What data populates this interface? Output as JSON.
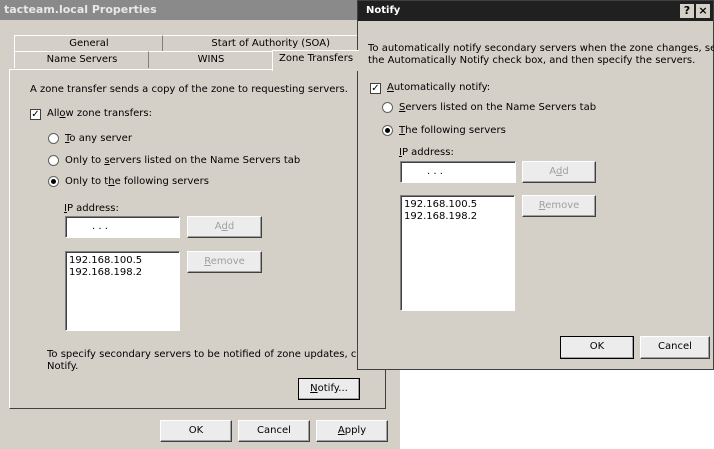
{
  "props": {
    "title": "tacteam.local Properties",
    "tabs_back": [
      "General",
      "Start of Authority (SOA)"
    ],
    "tabs_front": [
      "Name Servers",
      "WINS",
      "Zone Transfers"
    ],
    "intro": "A zone transfer sends a copy of the zone to requesting servers.",
    "allow_prefix": "All",
    "allow_ul": "o",
    "allow_suffix": "w zone transfers:",
    "opt1_ul": "T",
    "opt1_rest": "o any server",
    "opt2_prefix": "Only to ",
    "opt2_ul": "s",
    "opt2_suffix": "ervers listed on the Name Servers tab",
    "opt3_prefix": "Only to t",
    "opt3_ul": "h",
    "opt3_suffix": "e following servers",
    "ip_ul": "I",
    "ip_rest": "P address:",
    "ip_placeholder": ".     .     .",
    "add_prefix": "A",
    "add_ul": "d",
    "add_suffix": "d",
    "remove_ul": "R",
    "remove_rest": "emove",
    "servers": [
      "192.168.100.5",
      "192.168.198.2"
    ],
    "notify_note_1": "To specify secondary servers to be notified of zone updates, click",
    "notify_note_2": "Notify.",
    "notify_ul": "N",
    "notify_rest": "otify...",
    "ok": "OK",
    "cancel": "Cancel",
    "apply_ul": "A",
    "apply_rest": "pply"
  },
  "notify": {
    "title": "Notify",
    "help": "?",
    "close": "×",
    "desc_1": "To automatically notify secondary servers when the zone changes, select",
    "desc_2": "the Automatically Notify check box, and then specify the servers.",
    "auto_ul": "A",
    "auto_rest": "utomatically notify:",
    "opt1_ul": "S",
    "opt1_rest": "ervers listed on the Name Servers tab",
    "opt2_ul": "T",
    "opt2_rest": "he following servers",
    "ip_ul": "I",
    "ip_rest": "P address:",
    "ip_placeholder": ".     .     .",
    "add_prefix": "A",
    "add_ul": "d",
    "add_suffix": "d",
    "remove_ul": "R",
    "remove_rest": "emove",
    "servers": [
      "192.168.100.5",
      "192.168.198.2"
    ],
    "ok": "OK",
    "cancel": "Cancel"
  }
}
